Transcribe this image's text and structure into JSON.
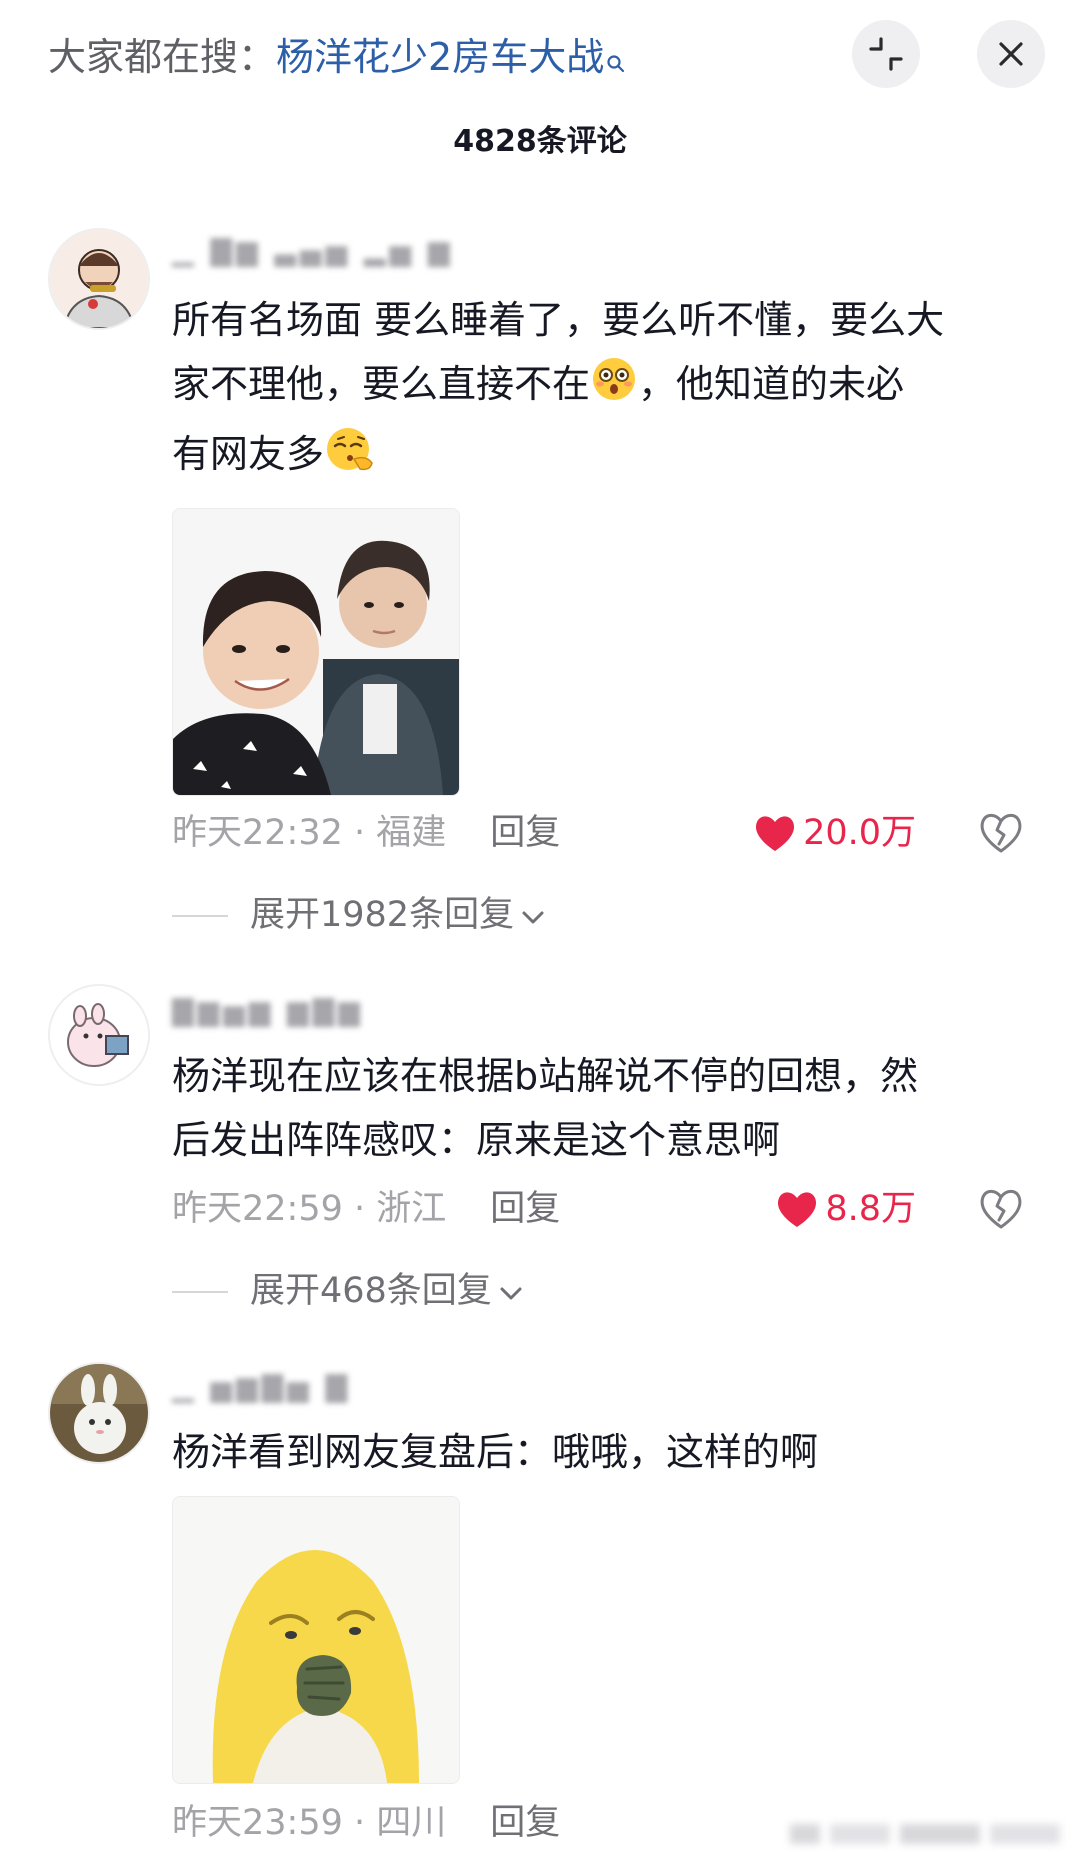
{
  "header": {
    "search_prefix": "大家都在搜：",
    "search_term": "杨洋花少2房车大战",
    "comment_count": "4828条评论"
  },
  "colors": {
    "accent_link": "#2d5fa8",
    "like_red": "#e8264b",
    "meta_gray": "#a3a3a8"
  },
  "comments": [
    {
      "text_line1": "所有名场面 要么睡着了，要么听不懂，要么大",
      "text_line2a": "家不理他，要么直接不在",
      "text_line2b": "，他知道的未必",
      "text_line3": "有网友多",
      "emoji_1": "flushed-emoji",
      "emoji_2": "smirk-emoji",
      "time": "昨天22:32",
      "location": "福建",
      "reply": "回复",
      "likes": "20.0万",
      "expand": "展开1982条回复"
    },
    {
      "text_line1": "杨洋现在应该在根据b站解说不停的回想，然",
      "text_line2": "后发出阵阵感叹：原来是这个意思啊",
      "time": "昨天22:59",
      "location": "浙江",
      "reply": "回复",
      "likes": "8.8万",
      "expand": "展开468条回复"
    },
    {
      "text_line1": "杨洋看到网友复盘后：哦哦，这样的啊",
      "time": "昨天23:59",
      "location": "四川",
      "reply": "回复"
    }
  ]
}
